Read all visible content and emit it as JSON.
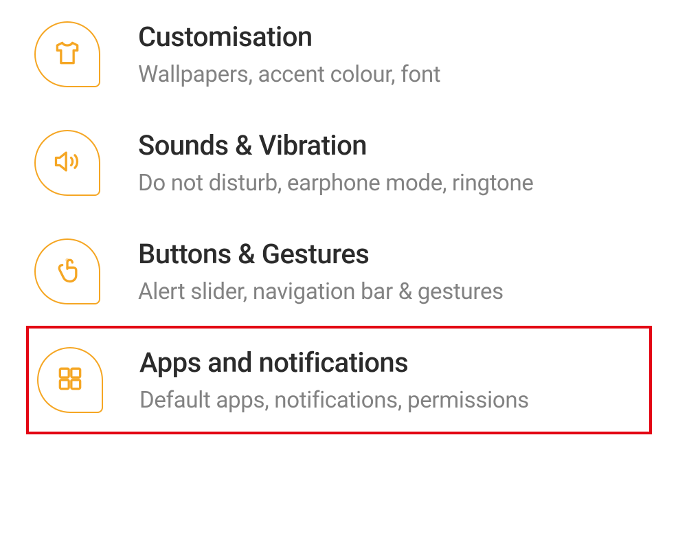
{
  "accent_color": "#f5a623",
  "highlight_color": "#e30613",
  "settings": [
    {
      "title": "Customisation",
      "subtitle": "Wallpapers, accent colour, font",
      "icon": "tshirt",
      "highlighted": false
    },
    {
      "title": "Sounds & Vibration",
      "subtitle": "Do not disturb, earphone mode, ringtone",
      "icon": "sound",
      "highlighted": false
    },
    {
      "title": "Buttons & Gestures",
      "subtitle": "Alert slider, navigation bar & gestures",
      "icon": "touch",
      "highlighted": false
    },
    {
      "title": "Apps and notifications",
      "subtitle": "Default apps, notifications, permissions",
      "icon": "apps",
      "highlighted": true
    }
  ]
}
